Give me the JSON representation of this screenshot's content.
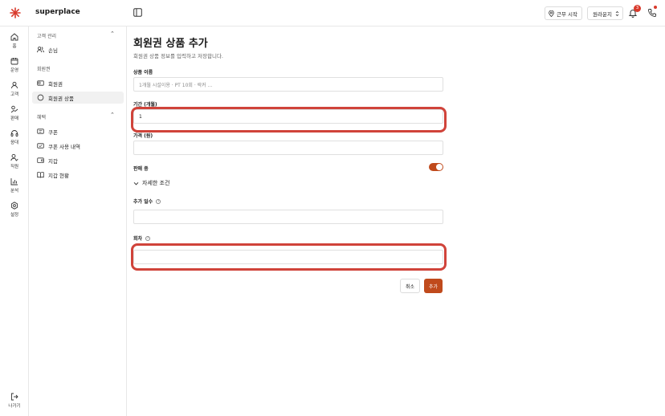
{
  "header": {
    "brand": "superplace",
    "work_start_label": "근무 시작",
    "store_label": "원라운지",
    "notification_count": "3"
  },
  "rail": {
    "items": [
      {
        "label": "홈",
        "icon": "home-icon"
      },
      {
        "label": "운영",
        "icon": "calendar-icon"
      },
      {
        "label": "고객",
        "icon": "user-icon"
      },
      {
        "label": "판매",
        "icon": "sales-icon"
      },
      {
        "label": "응대",
        "icon": "headset-icon"
      },
      {
        "label": "직원",
        "icon": "staff-icon"
      },
      {
        "label": "분석",
        "icon": "chart-icon"
      },
      {
        "label": "설정",
        "icon": "gear-icon"
      }
    ],
    "exit_label": "나가기"
  },
  "subnav": {
    "sections": [
      {
        "title": "고객 관리",
        "items": [
          {
            "label": "손님",
            "icon": "people-icon"
          }
        ]
      },
      {
        "title": "회원권",
        "items": [
          {
            "label": "회원권",
            "icon": "card-icon"
          },
          {
            "label": "회원권 상품",
            "icon": "circle-icon"
          }
        ]
      },
      {
        "title": "혜택",
        "items": [
          {
            "label": "쿠폰",
            "icon": "coupon-icon"
          },
          {
            "label": "쿠폰 사용 내역",
            "icon": "coupon-history-icon"
          },
          {
            "label": "지갑",
            "icon": "wallet-icon"
          },
          {
            "label": "지갑 현황",
            "icon": "book-icon"
          }
        ]
      }
    ]
  },
  "form": {
    "title": "회원권 상품 추가",
    "subtitle": "회원권 상품 정보를 입력하고 저장합니다.",
    "name_label": "상품 이름",
    "name_placeholder": "1개월 시설이용 · PT 10회 · 락커 ...",
    "period_label": "기간 (개월)",
    "period_value": "1",
    "price_label": "가격 (원)",
    "on_sale_label": "판매 중",
    "on_sale": true,
    "details_label": "자세한 조건",
    "extra_days_label": "추가 일수",
    "sessions_label": "회차",
    "cancel_label": "취소",
    "add_label": "추가"
  },
  "colors": {
    "accent": "#c04a1c",
    "highlight": "#d0433a",
    "badge": "#d93a2c"
  }
}
